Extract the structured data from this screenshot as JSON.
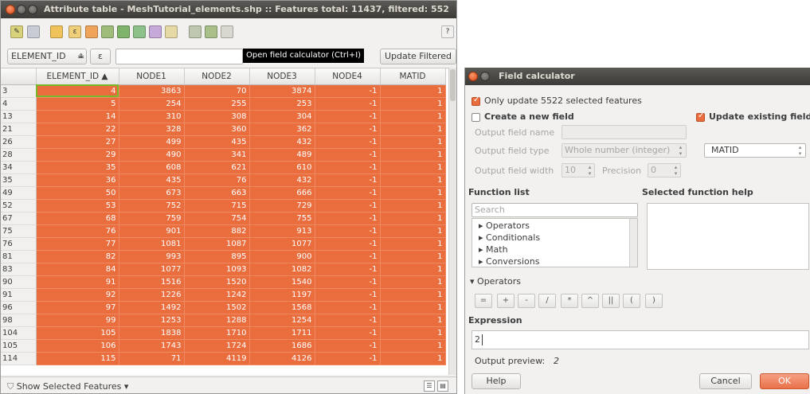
{
  "attribute_table": {
    "title": "Attribute table - MeshTutorial_elements.shp :: Features total: 11437, filtered: 552",
    "toolbar_icons": [
      "edit-pencil-icon",
      "save-icon",
      "new-feature-icon",
      "expression-select-icon",
      "select-all-icon",
      "invert-selection-icon",
      "deselect-icon",
      "move-selection-top-icon",
      "pan-to-selection-icon",
      "zoom-to-selection-icon",
      "copy-icon",
      "paste-icon",
      "delete-column-icon",
      "new-column-icon",
      "field-calculator-icon",
      "help-icon"
    ],
    "filter_field": "ELEMENT_ID",
    "filter_operator": "=",
    "expression_symbol": "ε",
    "tooltip": "Open field calculator (Ctrl+I)",
    "update_button": "Update Filtered",
    "columns": [
      "ELEMENT_ID ▲",
      "NODE1",
      "NODE2",
      "NODE3",
      "NODE4",
      "MATID"
    ],
    "rows": [
      [
        "3",
        "4",
        "3863",
        "70",
        "3874",
        "-1",
        "1"
      ],
      [
        "4",
        "5",
        "254",
        "255",
        "253",
        "-1",
        "1"
      ],
      [
        "13",
        "14",
        "310",
        "308",
        "304",
        "-1",
        "1"
      ],
      [
        "21",
        "22",
        "328",
        "360",
        "362",
        "-1",
        "1"
      ],
      [
        "26",
        "27",
        "499",
        "435",
        "432",
        "-1",
        "1"
      ],
      [
        "28",
        "29",
        "490",
        "341",
        "489",
        "-1",
        "1"
      ],
      [
        "34",
        "35",
        "608",
        "621",
        "610",
        "-1",
        "1"
      ],
      [
        "35",
        "36",
        "435",
        "76",
        "432",
        "-1",
        "1"
      ],
      [
        "49",
        "50",
        "673",
        "663",
        "666",
        "-1",
        "1"
      ],
      [
        "52",
        "53",
        "752",
        "715",
        "729",
        "-1",
        "1"
      ],
      [
        "67",
        "68",
        "759",
        "754",
        "755",
        "-1",
        "1"
      ],
      [
        "75",
        "76",
        "901",
        "882",
        "913",
        "-1",
        "1"
      ],
      [
        "76",
        "77",
        "1081",
        "1087",
        "1077",
        "-1",
        "1"
      ],
      [
        "81",
        "82",
        "993",
        "895",
        "900",
        "-1",
        "1"
      ],
      [
        "83",
        "84",
        "1077",
        "1093",
        "1082",
        "-1",
        "1"
      ],
      [
        "90",
        "91",
        "1516",
        "1520",
        "1540",
        "-1",
        "1"
      ],
      [
        "91",
        "92",
        "1226",
        "1242",
        "1197",
        "-1",
        "1"
      ],
      [
        "96",
        "97",
        "1492",
        "1502",
        "1568",
        "-1",
        "1"
      ],
      [
        "98",
        "99",
        "1253",
        "1288",
        "1254",
        "-1",
        "1"
      ],
      [
        "104",
        "105",
        "1838",
        "1710",
        "1711",
        "-1",
        "1"
      ],
      [
        "105",
        "106",
        "1743",
        "1724",
        "1686",
        "-1",
        "1"
      ],
      [
        "114",
        "115",
        "71",
        "4119",
        "4126",
        "-1",
        "1"
      ]
    ],
    "show_features": "Show Selected Features"
  },
  "field_calculator": {
    "title": "Field calculator",
    "only_update": "Only update 5522 selected features",
    "create_new_field": "Create a new field",
    "update_existing_field": "Update existing field",
    "output_field_name": "Output field name",
    "output_field_type": "Output field type",
    "field_type_value": "Whole number (integer)",
    "output_field_width": "Output field width",
    "width_value": "10",
    "precision": "Precision",
    "precision_value": "0",
    "existing_field": "MATID",
    "function_list": "Function list",
    "selected_function_help": "Selected function help",
    "search_placeholder": "Search",
    "functions": [
      "Operators",
      "Conditionals",
      "Math",
      "Conversions"
    ],
    "operators_section": "Operators",
    "operators": [
      "=",
      "+",
      "-",
      "/",
      "*",
      "^",
      "||",
      "(",
      ")"
    ],
    "expression_label": "Expression",
    "expression_value": "2",
    "output_preview_label": "Output preview:",
    "output_preview_value": "2",
    "help_button": "Help",
    "cancel_button": "Cancel",
    "ok_button": "OK"
  },
  "colors": {
    "selection": "#ea6d3e",
    "titlebar": "#3c3b37",
    "focus": "#78b82a"
  }
}
